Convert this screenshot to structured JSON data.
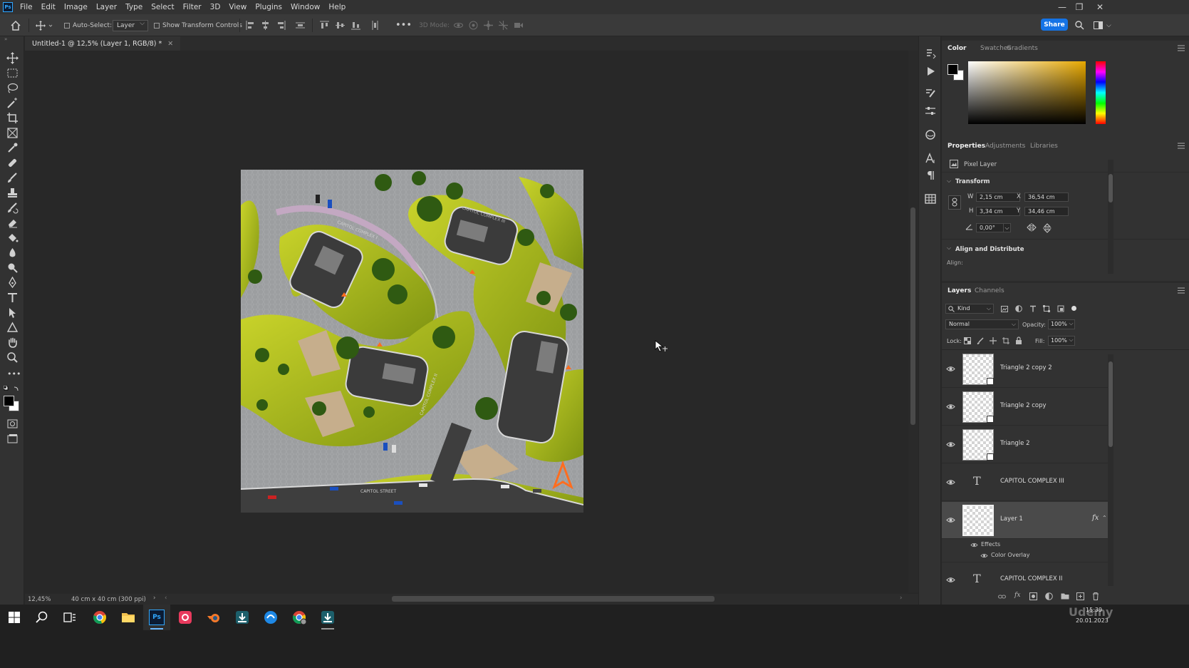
{
  "menubar": {
    "logo": "Ps",
    "items": [
      "File",
      "Edit",
      "Image",
      "Layer",
      "Type",
      "Select",
      "Filter",
      "3D",
      "View",
      "Plugins",
      "Window",
      "Help"
    ]
  },
  "options": {
    "auto_select_label": "Auto-Select:",
    "auto_select_value": "Layer",
    "show_transform_label": "Show Transform Controls",
    "three_d_mode_label": "3D Mode:",
    "share_label": "Share"
  },
  "document": {
    "tab_title": "Untitled-1 @ 12,5% (Layer 1, RGB/8) *",
    "zoom": "12,45%",
    "doc_info": "40 cm x 40 cm (300 ppi)"
  },
  "map": {
    "labels": [
      "CAPITOL COMPLEX I",
      "CAPITOL COMPLEX III",
      "CAPITOL COMPLEX II",
      "CAPITOL STREET"
    ]
  },
  "color_panel": {
    "tabs": [
      "Color",
      "Swatches",
      "Gradients"
    ],
    "foreground": "#000000",
    "background": "#ffffff",
    "hue_color": "#e7a800"
  },
  "properties_panel": {
    "tabs": [
      "Properties",
      "Adjustments",
      "Libraries"
    ],
    "layer_type": "Pixel Layer",
    "transform_title": "Transform",
    "w_label": "W",
    "w_value": "2,15 cm",
    "x_label": "X",
    "x_value": "36,54 cm",
    "h_label": "H",
    "h_value": "3,34 cm",
    "y_label": "Y",
    "y_value": "34,46 cm",
    "angle_value": "0,00°",
    "align_title": "Align and Distribute",
    "align_label": "Align:"
  },
  "layers_panel": {
    "tabs": [
      "Layers",
      "Channels"
    ],
    "kind_label": "Kind",
    "blend_mode": "Normal",
    "opacity_label": "Opacity:",
    "opacity_value": "100%",
    "lock_label": "Lock:",
    "fill_label": "Fill:",
    "fill_value": "100%",
    "layers": [
      {
        "name": "Triangle 2 copy 2",
        "type": "smart"
      },
      {
        "name": "Triangle 2 copy",
        "type": "smart"
      },
      {
        "name": "Triangle 2",
        "type": "smart"
      },
      {
        "name": "CAPITOL COMPLEX III",
        "type": "text"
      },
      {
        "name": "Layer 1",
        "type": "pixel",
        "selected": true,
        "fx": "fx"
      },
      {
        "name": "CAPITOL COMPLEX II",
        "type": "text"
      }
    ],
    "effects_label": "Effects",
    "color_overlay_label": "Color Overlay"
  },
  "taskbar": {
    "time": "15:39",
    "date": "20.01.2023",
    "watermark": "Udemy"
  }
}
